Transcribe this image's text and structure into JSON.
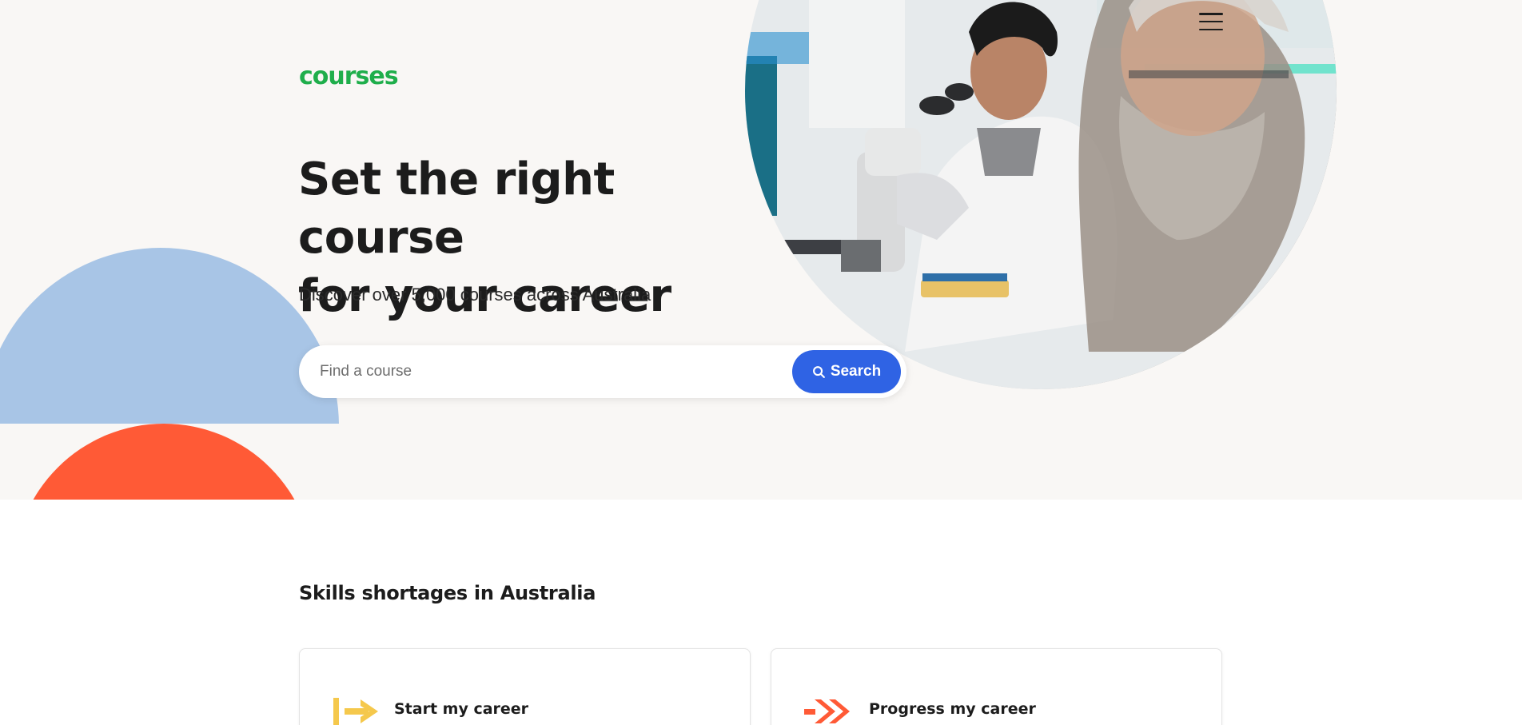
{
  "header": {
    "logo_text": "courses",
    "menu_icon": "hamburger-menu-icon"
  },
  "hero": {
    "headline_line1": "Set the right course",
    "headline_line2": "for your career",
    "subheading": "Discover over 5,000 courses across Australia",
    "search": {
      "placeholder": "Find a course",
      "value": "",
      "button_label": "Search",
      "button_icon": "search-icon"
    },
    "image_description": "scientist-looking-into-microscope"
  },
  "skills_section": {
    "title": "Skills shortages in Australia",
    "cards": [
      {
        "label": "Start my career",
        "icon": "arrow-right-icon",
        "icon_color": "#f5c84c"
      },
      {
        "label": "Progress my career",
        "icon": "double-chevron-right-icon",
        "icon_color": "#ff5a36"
      }
    ]
  },
  "colors": {
    "brand_green": "#1fae4b",
    "primary_blue": "#2f63e4",
    "hero_bg": "#f9f7f5",
    "shape_blue": "#a8c5e6",
    "shape_red": "#ff5a36"
  }
}
